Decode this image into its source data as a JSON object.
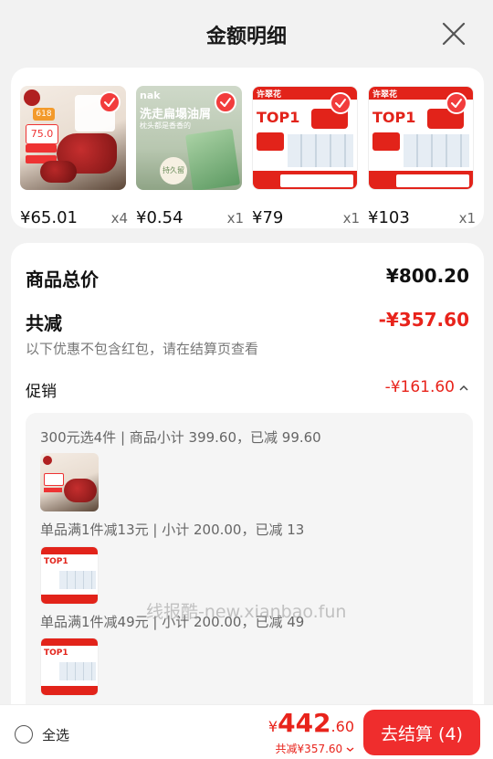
{
  "header": {
    "title": "金额明细"
  },
  "products": [
    {
      "price": "¥65.01",
      "qty": "x4",
      "theme": "beef",
      "badge": "618",
      "promo_price": "75.0"
    },
    {
      "price": "¥0.54",
      "qty": "x1",
      "theme": "shampoo",
      "brand": "nak",
      "headline": "洗走扁塌油屑",
      "subline": "枕头都是香香的",
      "tag": "持久留香"
    },
    {
      "price": "¥79",
      "qty": "x1",
      "theme": "tissue",
      "brand": "许翠花",
      "headline": "TOP1"
    },
    {
      "price": "¥103",
      "qty": "x1",
      "theme": "tissue",
      "brand": "许翠花",
      "headline": "TOP1"
    }
  ],
  "summary": {
    "total_label": "商品总价",
    "total_value": "¥800.20",
    "discount_label": "共减",
    "discount_value": "-¥357.60",
    "discount_note": "以下优惠不包含红包，请在结算页查看",
    "promo_label": "促销",
    "promo_value": "-¥161.60"
  },
  "promo_groups": [
    {
      "desc": "300元选4件 | 商品小计 399.60，已减 99.60",
      "theme": "beef"
    },
    {
      "desc": "单品满1件减13元 | 小计 200.00，已减 13",
      "theme": "tissue"
    },
    {
      "desc": "单品满1件减49元 | 小计 200.00，已减 49",
      "theme": "tissue"
    }
  ],
  "watermark": "线报酷-new.xianbao.fun",
  "footer": {
    "select_all": "全选",
    "currency": "¥",
    "total_int": "442",
    "total_dec": ".60",
    "total_saved": "共减¥357.60",
    "checkout_label": "去结算 (4)"
  },
  "colors": {
    "accent": "#ef2d2d",
    "text": "#222222",
    "muted": "#777777"
  }
}
